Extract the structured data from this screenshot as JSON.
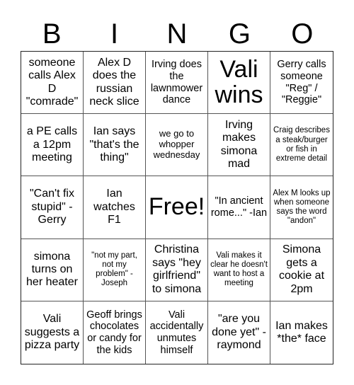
{
  "header": {
    "letters": [
      "B",
      "I",
      "N",
      "G",
      "O"
    ]
  },
  "cells": [
    {
      "text": "someone calls Alex D \"comrade\"",
      "size": "l"
    },
    {
      "text": "Alex D does the russian neck slice",
      "size": "l"
    },
    {
      "text": "Irving does the lawnmower dance",
      "size": "m"
    },
    {
      "text": "Vali wins",
      "size": "xl"
    },
    {
      "text": "Gerry calls someone \"Reg\" / \"Reggie\"",
      "size": "m"
    },
    {
      "text": "a PE calls a 12pm meeting",
      "size": "l"
    },
    {
      "text": "Ian says \"that's the thing\"",
      "size": "l"
    },
    {
      "text": "we go to whopper wednesday",
      "size": "s"
    },
    {
      "text": "Irving makes simona mad",
      "size": "l"
    },
    {
      "text": "Craig describes a steak/burger or fish in extreme detail",
      "size": "xs"
    },
    {
      "text": "\"Can't fix stupid\" -Gerry",
      "size": "l"
    },
    {
      "text": "Ian watches F1",
      "size": "l"
    },
    {
      "text": "Free!",
      "size": "xl"
    },
    {
      "text": "\"In ancient rome...\" -Ian",
      "size": "m"
    },
    {
      "text": "Alex M looks up when someone says the word \"andon\"",
      "size": "xs"
    },
    {
      "text": "simona turns on her heater",
      "size": "l"
    },
    {
      "text": "\"not my part, not my problem\" -Joseph",
      "size": "xs"
    },
    {
      "text": "Christina says \"hey girlfriend\" to simona",
      "size": "l"
    },
    {
      "text": "Vali makes it clear he doesn't want to host a meeting",
      "size": "xs"
    },
    {
      "text": "Simona gets a cookie at 2pm",
      "size": "l"
    },
    {
      "text": "Vali suggests a pizza party",
      "size": "l"
    },
    {
      "text": "Geoff brings chocolates or candy for the kids",
      "size": "m"
    },
    {
      "text": "Vali accidentally unmutes himself",
      "size": "m"
    },
    {
      "text": "\"are you done yet\" -raymond",
      "size": "l"
    },
    {
      "text": "Ian makes *the* face",
      "size": "l"
    }
  ]
}
